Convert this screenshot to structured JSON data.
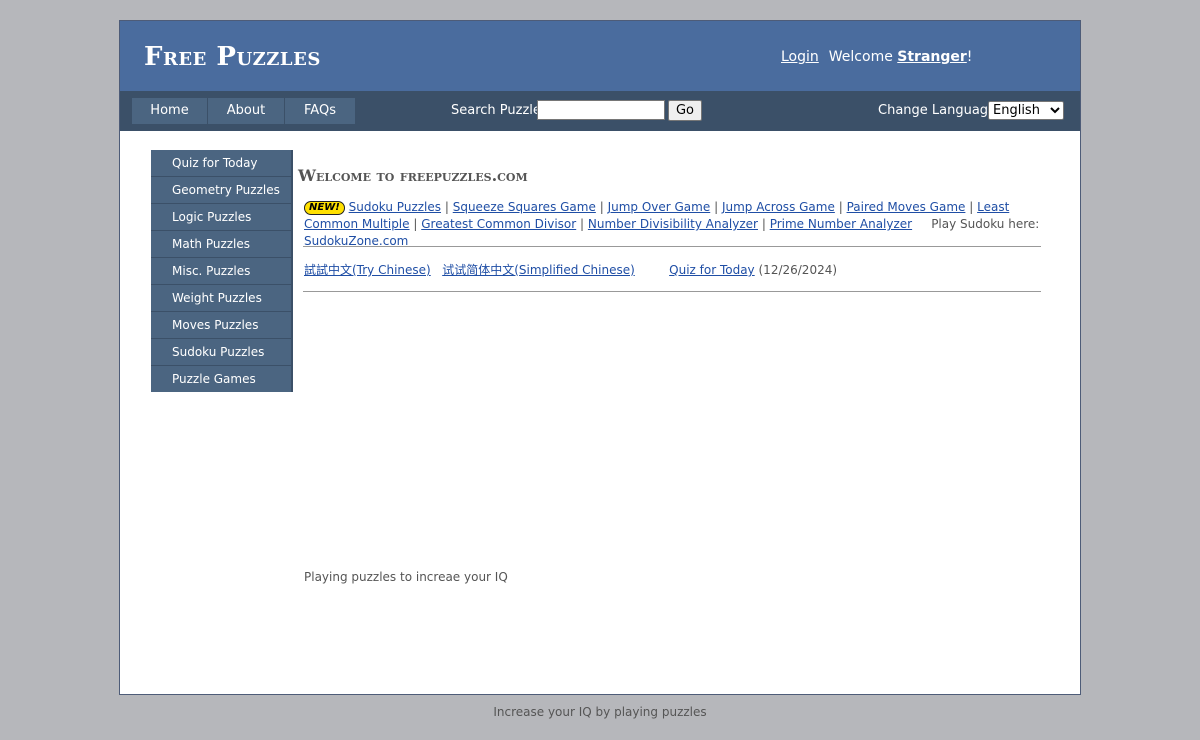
{
  "header": {
    "site_title": "Free Puzzles",
    "login_label": "Login",
    "welcome_prefix": "Welcome ",
    "user_name": "Stranger",
    "welcome_suffix": "!"
  },
  "nav": {
    "tabs": [
      {
        "label": "Home"
      },
      {
        "label": "About"
      },
      {
        "label": "FAQs"
      }
    ],
    "search_label": "Search Puzzles",
    "search_value": "",
    "go_label": "Go",
    "language_label": "Change Language:",
    "language_selected": "English"
  },
  "sidebar": {
    "items": [
      {
        "label": "Quiz for Today"
      },
      {
        "label": "Geometry Puzzles"
      },
      {
        "label": "Logic Puzzles"
      },
      {
        "label": "Math Puzzles"
      },
      {
        "label": "Misc. Puzzles"
      },
      {
        "label": "Weight Puzzles"
      },
      {
        "label": "Moves Puzzles"
      },
      {
        "label": "Sudoku Puzzles"
      },
      {
        "label": "Puzzle Games"
      }
    ]
  },
  "main": {
    "welcome_title": "Welcome to freepuzzles.com",
    "new_badge": "NEW!",
    "links": [
      {
        "label": "Sudoku Puzzles"
      },
      {
        "label": "Squeeze Squares Game"
      },
      {
        "label": "Jump Over Game"
      },
      {
        "label": "Jump Across Game"
      },
      {
        "label": "Paired Moves Game"
      },
      {
        "label": "Least Common Multiple"
      },
      {
        "label": "Greatest Common Divisor"
      },
      {
        "label": "Number Divisibility Analyzer"
      },
      {
        "label": "Prime Number Analyzer"
      }
    ],
    "separator": "|",
    "sudoku_prefix": "Play Sudoku here:",
    "sudoku_link": "SudokuZone.com",
    "try_chinese": "試試中文(Try Chinese)",
    "simplified_chinese": "试试简体中文(Simplified Chinese)",
    "quiz_link": "Quiz for Today",
    "quiz_date": "(12/26/2024)",
    "tagline": "Playing puzzles to increae your IQ"
  },
  "footer": {
    "text": "Increase your IQ by playing puzzles"
  },
  "colors": {
    "header_bg": "#4a6c9e",
    "nav_bg": "#3b5068",
    "tab_bg": "#4b6581",
    "link": "#1f4ea5",
    "page_bg": "#b6b7bb"
  }
}
